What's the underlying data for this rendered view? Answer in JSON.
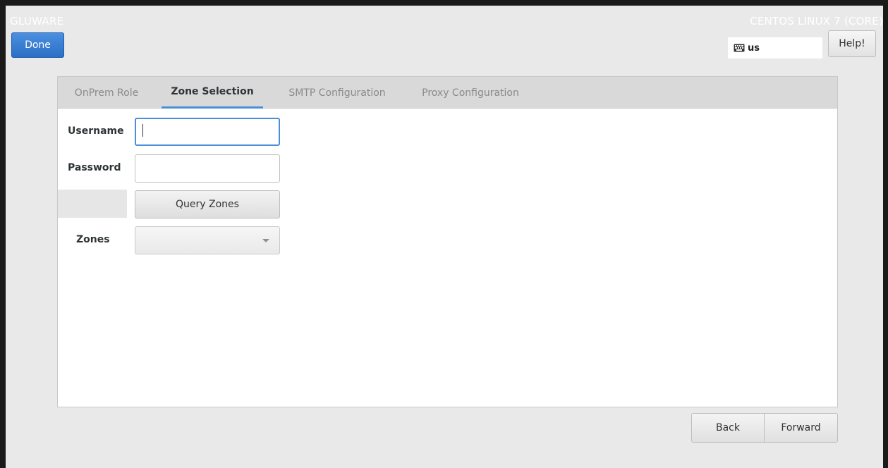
{
  "header": {
    "brand": "GLUWARE",
    "os_title": "CENTOS LINUX 7 (CORE)",
    "done_label": "Done",
    "keyboard_layout": "us",
    "help_label": "Help!"
  },
  "tabs": [
    {
      "label": "OnPrem Role",
      "active": false
    },
    {
      "label": "Zone Selection",
      "active": true
    },
    {
      "label": "SMTP Configuration",
      "active": false
    },
    {
      "label": "Proxy Configuration",
      "active": false
    }
  ],
  "form": {
    "username_label": "Username",
    "username_value": "",
    "password_label": "Password",
    "password_value": "",
    "query_button_label": "Query Zones",
    "zones_label": "Zones",
    "zones_selected": ""
  },
  "footer": {
    "back_label": "Back",
    "forward_label": "Forward"
  },
  "colors": {
    "accent": "#4a90d9",
    "done_button": "#2c6fc6",
    "background": "#e9e9e9"
  },
  "icons": {
    "keyboard": "keyboard-icon",
    "dropdown": "chevron-down-icon"
  }
}
